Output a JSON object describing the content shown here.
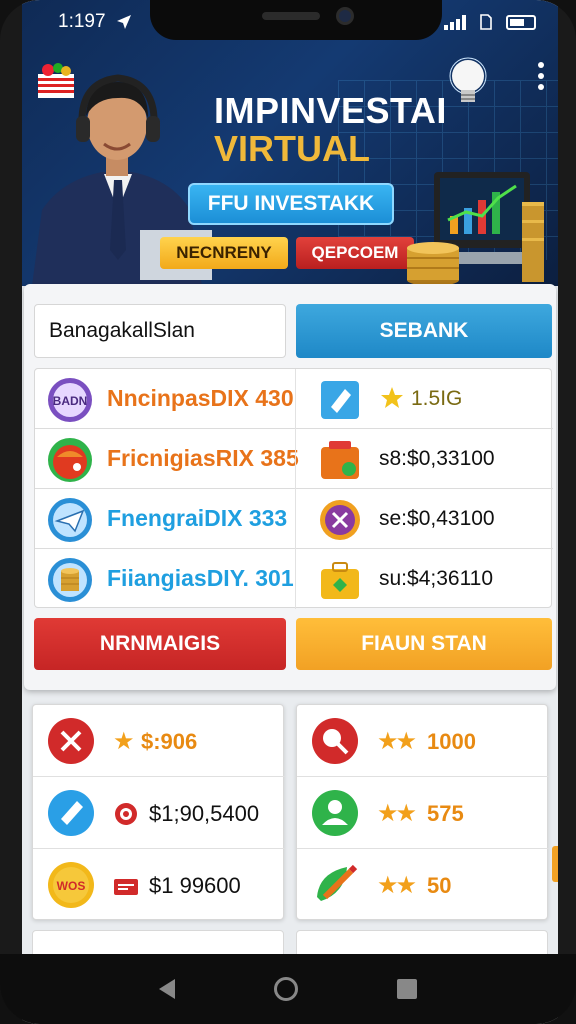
{
  "status_bar": {
    "time": "1:197",
    "location_icon": "navigation-arrow-icon"
  },
  "hero": {
    "title_line1": "IMPINVESTAI",
    "title_line2": "VIRTUAL",
    "main_button": "FFU INVESTAKK",
    "yellow_button": "NECNRENY",
    "red_button": "QEPCOEM"
  },
  "search": {
    "field_value": "BanagakallSlan",
    "button_label": "SEBANK"
  },
  "list_rows": [
    {
      "icon_label": "BADN",
      "name": "NncinpasDIX 430",
      "name_color": "#e8731a",
      "value": "1.5IG",
      "value_color": "#7a6a12"
    },
    {
      "icon_label": "",
      "name": "FricnigiasRIX 385",
      "name_color": "#e8731a",
      "value": "s8:$0,33100",
      "value_color": "#111111"
    },
    {
      "icon_label": "",
      "name": "FnengraiDIX 333",
      "name_color": "#1f9fe0",
      "value": "se:$0,43100",
      "value_color": "#111111"
    },
    {
      "icon_label": "",
      "name": "FiiangiasDIY. 301",
      "name_color": "#1f9fe0",
      "value": "su:$4;36110",
      "value_color": "#111111"
    }
  ],
  "actions": {
    "left_button": "NRNMAIGIS",
    "right_button": "FIAUN STAN"
  },
  "lower_left": [
    {
      "text": "$:906"
    },
    {
      "text": "$1;90,5400"
    },
    {
      "icon_label": "WOS",
      "text": "$1 99600"
    }
  ],
  "lower_right": [
    {
      "text": "1000"
    },
    {
      "text": "575"
    },
    {
      "text": "50"
    }
  ],
  "colors": {
    "accent_blue": "#1e88c7",
    "accent_red": "#c62525",
    "accent_orange": "#f2a124",
    "hero_bg": "#143a72"
  }
}
